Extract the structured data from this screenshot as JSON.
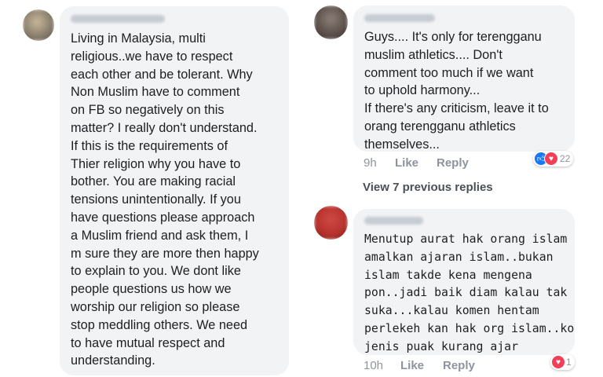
{
  "comments": [
    {
      "text": "Living in Malaysia, multi\nreligious..we have to respect\neach other and be tolerant. Why\nNon Muslim have to comment\non FB so negatively on this\nmatter? I really don't understand.\nIf this is the requirements of\nThier religion why you have to\nbother. You are making racial\ntensions unintentionally. If you\nhave questions please approach\na Muslim friend and ask them, I\nm sure they are more then happy\nto explain to you. We dont like\npeople questions us how we\nworship our religion so please\nstop meddling others. We need\nto have mutual respect and\nunderstanding.",
      "avatar_color": "#8a7f6e"
    },
    {
      "text": "Guys.... It's only for terengganu\nmuslim athletics.... Don't\ncomment too much if we want\nto uphold harmony...\nIf there's any criticism, leave it to\norang terengganu athletics\nthemselves...",
      "time": "9h",
      "like": "Like",
      "reply": "Reply",
      "reaction_count": "22",
      "avatar_color": "#6b5f5a"
    },
    {
      "text": "Menutup aurat hak orang islam\namalkan ajaran islam..bukan\nislam takde kena mengena\npon..jadi baik diam kalau tak\nsuka...kalau komen hentam\nperlekeh kan hak org islam..ko\njenis puak kurang ajar",
      "time": "10h",
      "like": "Like",
      "reply": "Reply",
      "reaction_count": "1",
      "avatar_color": "#b8322e"
    }
  ],
  "view_previous_replies": "View 7 previous replies",
  "icons": {
    "like_reaction": "thumbs-up-icon",
    "love_reaction": "heart-icon"
  }
}
